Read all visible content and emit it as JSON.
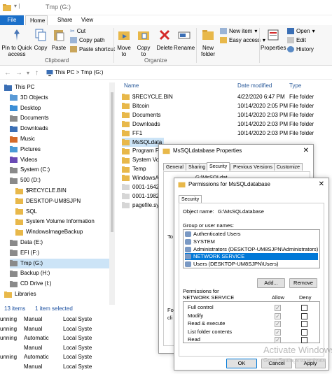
{
  "window": {
    "title": "Tmp (G:)"
  },
  "tabs": [
    "File",
    "Home",
    "Share",
    "View"
  ],
  "ribbon": {
    "pin_label": "Pin to Quick access",
    "copy_label": "Copy",
    "paste_label": "Paste",
    "cut_label": "Cut",
    "copy_path_label": "Copy path",
    "paste_shortcut_label": "Paste shortcut",
    "clipboard_group": "Clipboard",
    "move_to_label": "Move to",
    "copy_to_label": "Copy to",
    "delete_label": "Delete",
    "rename_label": "Rename",
    "organize_group": "Organize",
    "new_folder_label": "New folder",
    "new_item_label": "New item",
    "easy_access_label": "Easy access",
    "properties_label": "Properties",
    "open_label": "Open",
    "edit_label": "Edit",
    "history_label": "History"
  },
  "address": {
    "path": "This PC  >  Tmp (G:)"
  },
  "nav_tree": [
    {
      "label": "This PC",
      "indent": 0
    },
    {
      "label": "3D Objects",
      "indent": 1
    },
    {
      "label": "Desktop",
      "indent": 1
    },
    {
      "label": "Documents",
      "indent": 1
    },
    {
      "label": "Downloads",
      "indent": 1
    },
    {
      "label": "Music",
      "indent": 1
    },
    {
      "label": "Pictures",
      "indent": 1
    },
    {
      "label": "Videos",
      "indent": 1
    },
    {
      "label": "System (C:)",
      "indent": 1
    },
    {
      "label": "500 (D:)",
      "indent": 1
    },
    {
      "label": "$RECYCLE.BIN",
      "indent": 2
    },
    {
      "label": "DESKTOP-UM8SJPN",
      "indent": 2
    },
    {
      "label": "SQL",
      "indent": 2
    },
    {
      "label": "System Volume Information",
      "indent": 2
    },
    {
      "label": "WindowsImageBackup",
      "indent": 2
    },
    {
      "label": "Data (E:)",
      "indent": 1
    },
    {
      "label": "EFI (F:)",
      "indent": 1
    },
    {
      "label": "Tmp (G:)",
      "indent": 1
    },
    {
      "label": "Backup (H:)",
      "indent": 1
    },
    {
      "label": "CD Drive (I:)",
      "indent": 1
    },
    {
      "label": "Libraries",
      "indent": 0
    }
  ],
  "columns": {
    "name": "Name",
    "date": "Date modified",
    "type": "Type"
  },
  "files": [
    {
      "name": "$RECYCLE.BIN",
      "date": "4/22/2020 6:47 PM",
      "type": "File folder"
    },
    {
      "name": "Bitcoin",
      "date": "10/14/2020 2:05 PM",
      "type": "File folder"
    },
    {
      "name": "Documents",
      "date": "10/14/2020 2:03 PM",
      "type": "File folder"
    },
    {
      "name": "Downloads",
      "date": "10/14/2020 2:03 PM",
      "type": "File folder"
    },
    {
      "name": "FF1",
      "date": "10/14/2020 2:03 PM",
      "type": "File folder"
    },
    {
      "name": "MsSQLdata",
      "date": "",
      "type": ""
    },
    {
      "name": "Program F",
      "date": "",
      "type": ""
    },
    {
      "name": "System Vo",
      "date": "",
      "type": ""
    },
    {
      "name": "Temp",
      "date": "",
      "type": ""
    },
    {
      "name": "WindowsA",
      "date": "",
      "type": ""
    },
    {
      "name": "0001-1642.",
      "date": "",
      "type": ""
    },
    {
      "name": "0001-1982.",
      "date": "",
      "type": ""
    },
    {
      "name": "pagefile.sys",
      "date": "",
      "type": ""
    }
  ],
  "status": {
    "count": "13 items",
    "selected": "1 item selected"
  },
  "services": [
    {
      "status": "unning",
      "startup": "Manual",
      "logon": "Local Syste"
    },
    {
      "status": "unning",
      "startup": "Manual",
      "logon": "Local Syste"
    },
    {
      "status": "unning",
      "startup": "Automatic",
      "logon": "Local Syste"
    },
    {
      "status": "",
      "startup": "Manual",
      "logon": "Local Syste"
    },
    {
      "status": "unning",
      "startup": "Automatic",
      "logon": "Local Syste"
    },
    {
      "status": "",
      "startup": "Manual",
      "logon": "Local Syste"
    }
  ],
  "props_dialog": {
    "title": "MsSQLdatabase Properties",
    "tabs": [
      "General",
      "Sharing",
      "Security",
      "Previous Versions",
      "Customize"
    ],
    "obj_name_partial": "G:\\MsSQLdat",
    "to_text": "To",
    "for_text": "For",
    "cli_text": "cli"
  },
  "perm_dialog": {
    "title": "Permissions for MsSQLdatabase",
    "tab": "Security",
    "object_name_label": "Object name:",
    "object_name_value": "G:\\MsSQLdatabase",
    "group_label": "Group or user names:",
    "users": [
      "Authenticated Users",
      "SYSTEM",
      "Administrators (DESKTOP-UM8SJPN\\Administrators)",
      "NETWORK SERVICE",
      "Users (DESKTOP-UM8SJPN\\Users)"
    ],
    "selected_user_index": 3,
    "add_label": "Add...",
    "remove_label": "Remove",
    "perm_header": "Permissions for NETWORK SERVICE",
    "allow_label": "Allow",
    "deny_label": "Deny",
    "permissions": [
      {
        "name": "Full control",
        "allow": true,
        "deny": false
      },
      {
        "name": "Modify",
        "allow": true,
        "deny": false
      },
      {
        "name": "Read & execute",
        "allow": true,
        "deny": false
      },
      {
        "name": "List folder contents",
        "allow": true,
        "deny": false
      },
      {
        "name": "Read",
        "allow": true,
        "deny": false
      }
    ],
    "ok_label": "OK",
    "cancel_label": "Cancel",
    "apply_label": "Apply"
  },
  "watermark": {
    "line1": "Activate Windows",
    "line2": "Go to Settings to activate"
  }
}
